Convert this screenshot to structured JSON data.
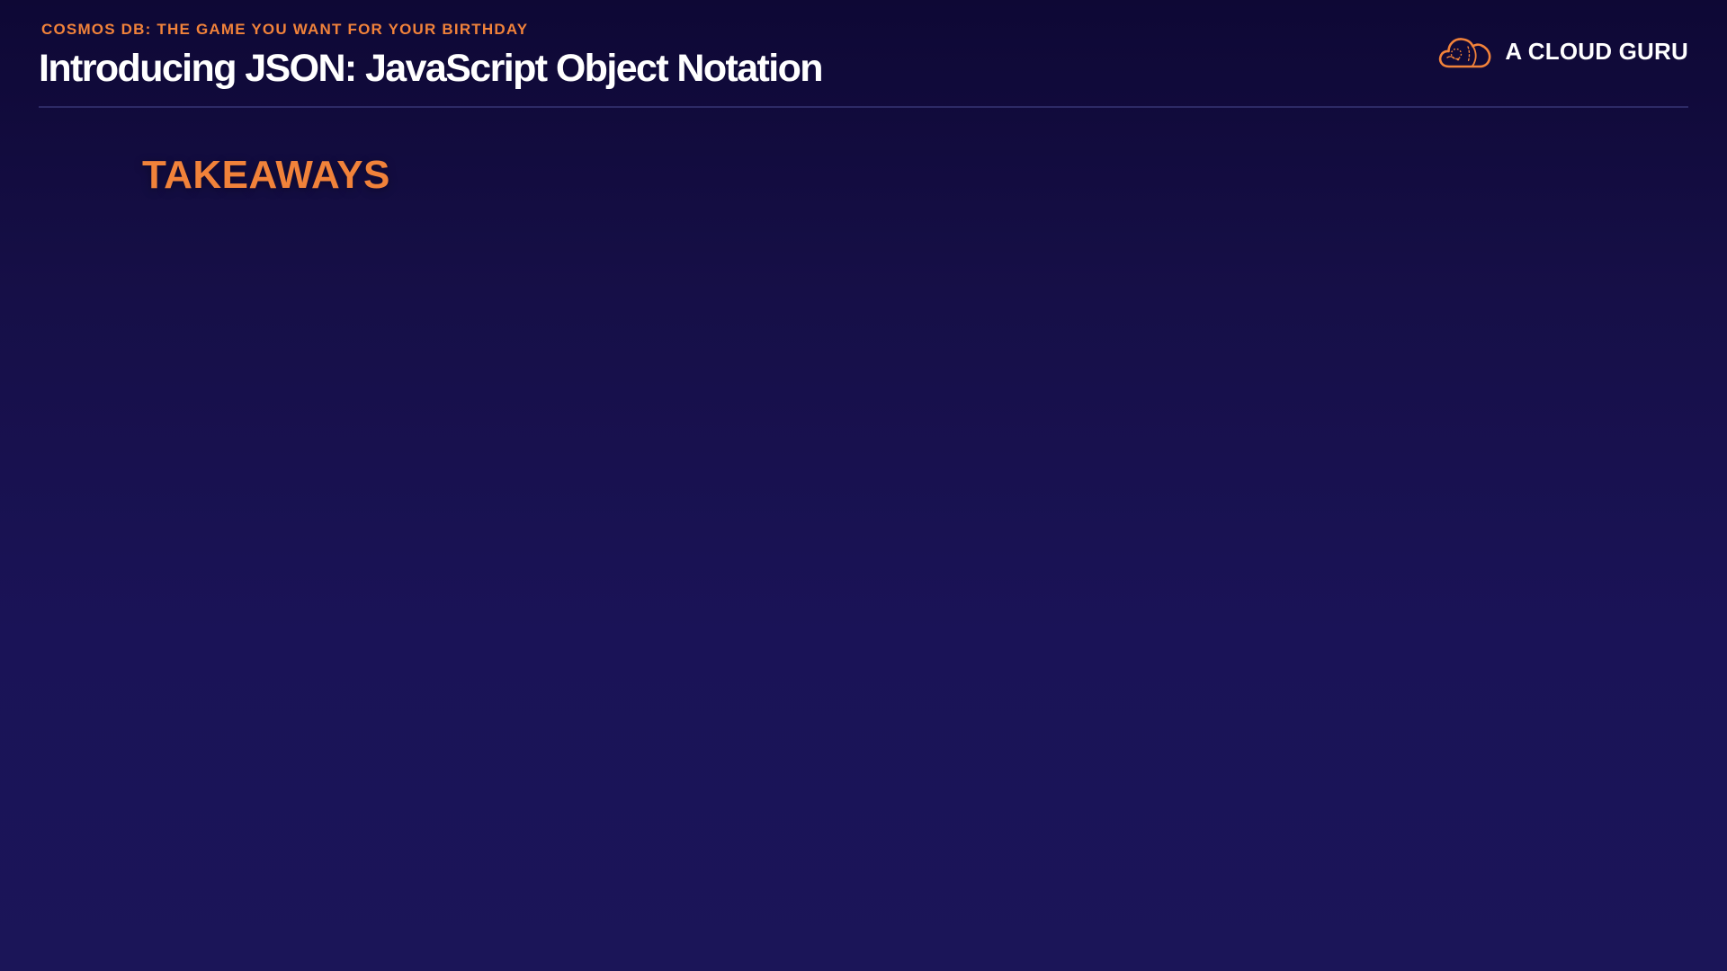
{
  "header": {
    "eyebrow": "COSMOS DB: THE GAME YOU WANT FOR YOUR BIRTHDAY",
    "title": "Introducing JSON: JavaScript Object Notation"
  },
  "brand": {
    "name": "A CLOUD GURU",
    "icon": "cloud-logo-icon"
  },
  "content": {
    "heading": "TAKEAWAYS"
  },
  "colors": {
    "accent": "#f1823a",
    "background": "#1a1357",
    "title": "#ffffff"
  }
}
